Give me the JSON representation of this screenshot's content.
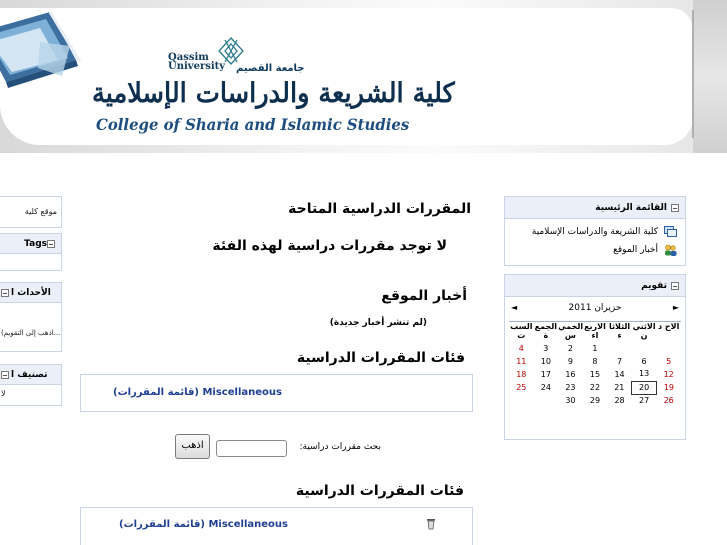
{
  "header": {
    "university_en": "Qassim University",
    "university_ar": "جامعة القصيم",
    "college_ar": "كلية الشريعة والدراسات الإسلامية",
    "college_en": "College of Sharia and Islamic Studies"
  },
  "left_column": {
    "site_block_text": "موقع كلية",
    "tags_title": "Tags",
    "events_title": "الأحداث ا",
    "events_link": "(اذهب إلى التقويم...",
    "classify_title": "تصنيف ا",
    "classify_text": "لا"
  },
  "main_menu": {
    "title": "القائمة الرئيسية",
    "items": [
      {
        "label": "كلية الشريعة والدراسات الإسلامية",
        "icon": "forum-icon"
      },
      {
        "label": "أخبار الموقع",
        "icon": "users-icon"
      }
    ]
  },
  "calendar": {
    "title": "تقويم",
    "month": "حزيران 2011",
    "prev": "◄",
    "next": "►",
    "weekdays": [
      "السب ت",
      "الجمع ة",
      "الخمي س",
      "الاربع اء",
      "الثلاثا ء",
      "الاثني ن",
      "الاح د"
    ],
    "weeks": [
      [
        "4",
        "3",
        "2",
        "1",
        "",
        "",
        ""
      ],
      [
        "11",
        "10",
        "9",
        "8",
        "7",
        "6",
        "5"
      ],
      [
        "18",
        "17",
        "16",
        "15",
        "14",
        "13",
        "12"
      ],
      [
        "25",
        "24",
        "23",
        "22",
        "21",
        "20",
        "19"
      ],
      [
        "",
        "",
        "30",
        "29",
        "28",
        "27",
        "26"
      ]
    ],
    "today": "20"
  },
  "main": {
    "available_courses": "المقررات الدراسية المتاحة",
    "no_courses": "لا توجد مقررات دراسية لهذه الفئة",
    "site_news": "أخبار الموقع",
    "no_news": "(لم تنشر أخبار جديدة)",
    "course_categories": "فئات المقررات الدراسية",
    "category_link": "Miscellaneous (قائمة المقررات)",
    "search_label": "بحث مقررات دراسية:",
    "search_value": "",
    "go_button": "اذهب",
    "course_categories_2": "فئات المقررات الدراسية",
    "category_link_2": "Miscellaneous (قائمة المقررات)"
  },
  "colors": {
    "block_border": "#c9d5e7",
    "block_header": "#eaeff8",
    "link": "#1f3f93",
    "weekend": "#bb0000",
    "brand_dark": "#0f2f4e"
  }
}
